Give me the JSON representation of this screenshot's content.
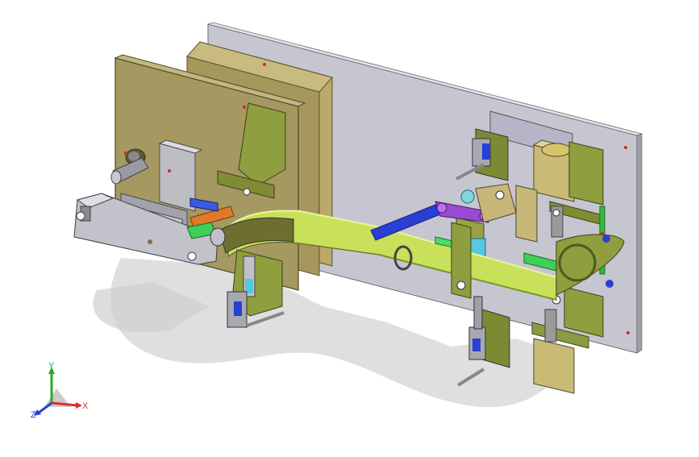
{
  "viewport": {
    "background": "#ffffff",
    "colors": {
      "plate": "#c8c8d2",
      "tan": "#a89a5a",
      "olive": "#8f9a3c",
      "lime": "#c8e05a",
      "blue": "#2a3fd6",
      "purple": "#8a4bd0",
      "orange": "#e07a2a",
      "cyan": "#58c8e0",
      "green": "#3fd05a",
      "shadow": "#d9d9d9"
    }
  },
  "triad": {
    "x_label": "X",
    "y_label": "Y",
    "z_label": "Z",
    "x_color": "#d63030",
    "y_color": "#2aa82a",
    "z_color": "#2a3fd6"
  }
}
